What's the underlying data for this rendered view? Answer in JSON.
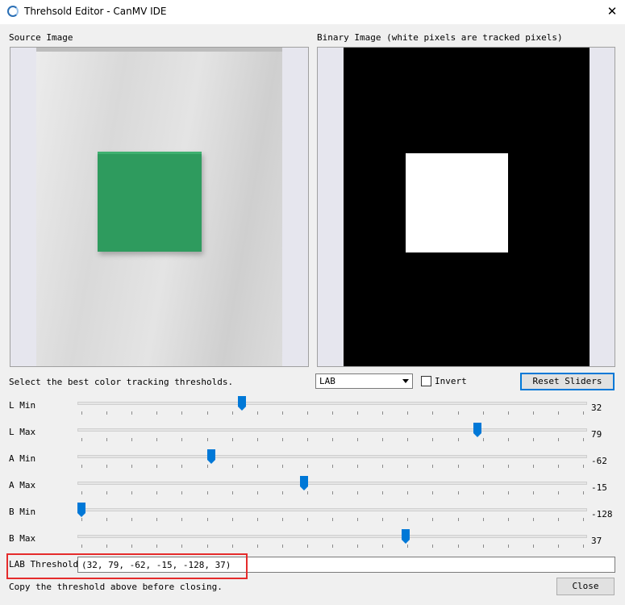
{
  "window": {
    "title": "Threhsold Editor - CanMV IDE",
    "app_icon": "canmv-logo-icon",
    "close_icon": "close-icon",
    "close_glyph": "✕"
  },
  "source_image": {
    "label": "Source Image"
  },
  "binary_image": {
    "label": "Binary Image (white pixels are tracked pixels)"
  },
  "instructions": "Select the best color tracking thresholds.",
  "color_space": {
    "selected": "LAB"
  },
  "invert": {
    "label": "Invert",
    "checked": false
  },
  "reset_button": {
    "label": "Reset Sliders"
  },
  "sliders": [
    {
      "label": "L Min",
      "value": "32"
    },
    {
      "label": "L Max",
      "value": "79"
    },
    {
      "label": "A Min",
      "value": "-62"
    },
    {
      "label": "A Max",
      "value": "-15"
    },
    {
      "label": "B Min",
      "value": "-128"
    },
    {
      "label": "B Max",
      "value": "37"
    }
  ],
  "lab_threshold": {
    "label": "LAB Threshold",
    "value": "(32, 79, -62, -15, -128, 37)"
  },
  "footer_note": "Copy the threshold above before closing.",
  "close_button": {
    "label": "Close"
  },
  "colors": {
    "accent": "#0078d7",
    "highlight": "#e52b2b",
    "object": "#2e9b5e"
  }
}
